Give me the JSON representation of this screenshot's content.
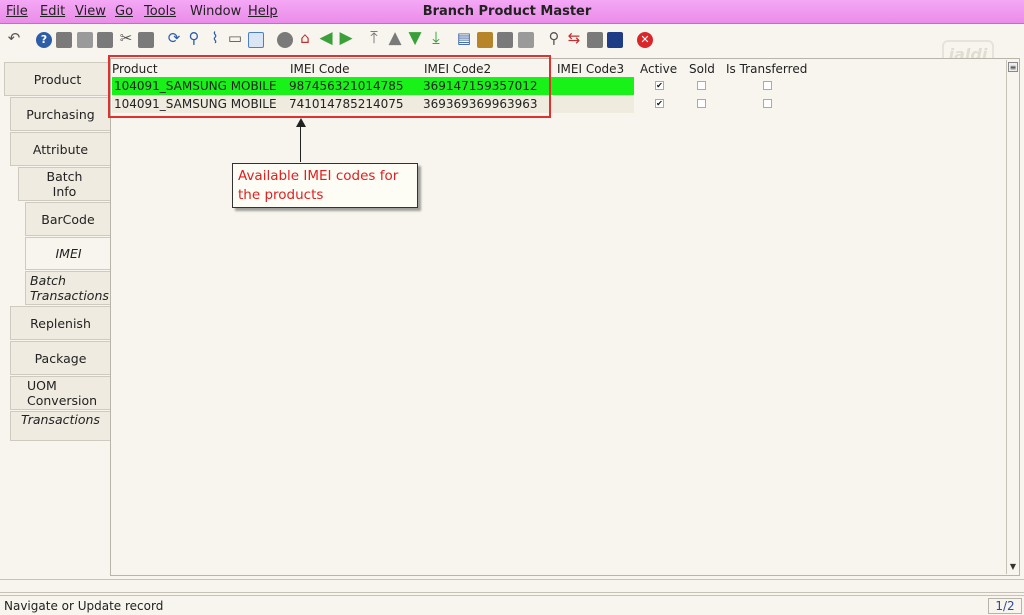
{
  "menu": {
    "file": "File",
    "edit": "Edit",
    "view": "View",
    "go": "Go",
    "tools": "Tools",
    "window": "Window",
    "help": "Help"
  },
  "window_title": "Branch Product Master",
  "logo_text": "jaldi",
  "toolbar_icons": [
    "undo-icon",
    "help-icon",
    "new-icon",
    "copy-icon",
    "delete-icon",
    "cut-icon",
    "save-icon",
    "refresh-icon",
    "find-icon",
    "attachment-icon",
    "chat-icon",
    "grid-toggle-icon",
    "history-icon",
    "home-icon",
    "back-icon",
    "forward-icon",
    "first-record-icon",
    "previous-record-icon",
    "next-record-icon",
    "last-record-icon",
    "report-icon",
    "archive-icon",
    "print-icon",
    "print-preview-icon",
    "zoom-icon",
    "workflow-icon",
    "request-icon",
    "product-info-icon",
    "close-icon"
  ],
  "tabs": [
    {
      "label": "Product"
    },
    {
      "label": "Purchasing"
    },
    {
      "label": "Attribute"
    },
    {
      "label": "Batch\nInfo"
    },
    {
      "label": "BarCode"
    },
    {
      "label": "IMEI"
    },
    {
      "label": "Batch\nTransactions"
    },
    {
      "label": "Replenish"
    },
    {
      "label": "Package"
    },
    {
      "label": "UOM\nConversion"
    },
    {
      "label": "Transactions"
    }
  ],
  "grid": {
    "columns": [
      "Product",
      "IMEI Code",
      "IMEI Code2",
      "IMEI Code3",
      "Active",
      "Sold",
      "Is Transferred"
    ],
    "rows": [
      {
        "product": "104091_SAMSUNG MOBILE",
        "imei1": "987456321014785",
        "imei2": "369147159357012",
        "imei3": "",
        "active": true,
        "sold": false,
        "transferred": false
      },
      {
        "product": "104091_SAMSUNG MOBILE",
        "imei1": "741014785214075",
        "imei2": "369369369963963",
        "imei3": "",
        "active": true,
        "sold": false,
        "transferred": false
      }
    ]
  },
  "annotation": {
    "text": "Available IMEI codes for the products"
  },
  "status": {
    "message": "Navigate or Update record",
    "page": "1/2"
  },
  "colors": {
    "menubar": "#ea8cea",
    "selected_row": "#19f219",
    "annotation_red": "#e02020"
  }
}
